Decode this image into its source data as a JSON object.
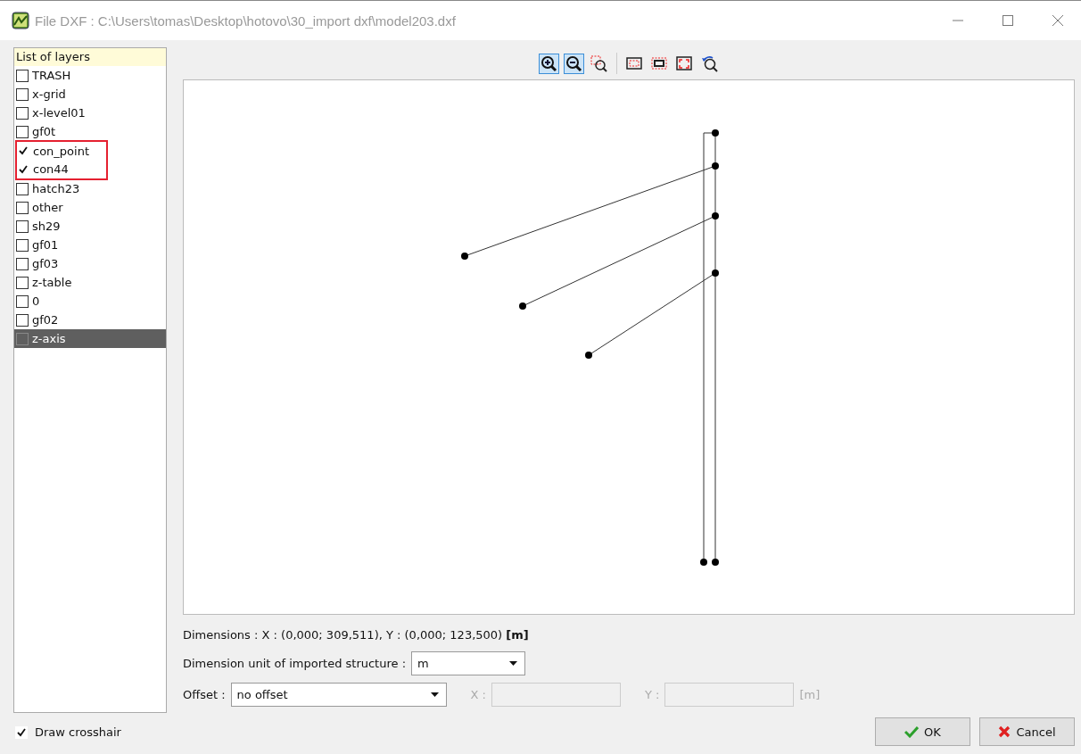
{
  "window": {
    "title": "File DXF : C:\\Users\\tomas\\Desktop\\hotovo\\30_import dxf\\model203.dxf"
  },
  "layers": {
    "header": "List of layers",
    "items": [
      {
        "label": "TRASH",
        "checked": false,
        "selected": false,
        "highlighted": false
      },
      {
        "label": "x-grid",
        "checked": false,
        "selected": false,
        "highlighted": false
      },
      {
        "label": "x-level01",
        "checked": false,
        "selected": false,
        "highlighted": false
      },
      {
        "label": "gf0t",
        "checked": false,
        "selected": false,
        "highlighted": false
      },
      {
        "label": "con_point",
        "checked": true,
        "selected": false,
        "highlighted": true
      },
      {
        "label": "con44",
        "checked": true,
        "selected": false,
        "highlighted": true
      },
      {
        "label": "hatch23",
        "checked": false,
        "selected": false,
        "highlighted": false
      },
      {
        "label": "other",
        "checked": false,
        "selected": false,
        "highlighted": false
      },
      {
        "label": "sh29",
        "checked": false,
        "selected": false,
        "highlighted": false
      },
      {
        "label": "gf01",
        "checked": false,
        "selected": false,
        "highlighted": false
      },
      {
        "label": "gf03",
        "checked": false,
        "selected": false,
        "highlighted": false
      },
      {
        "label": "z-table",
        "checked": false,
        "selected": false,
        "highlighted": false
      },
      {
        "label": "0",
        "checked": false,
        "selected": false,
        "highlighted": false
      },
      {
        "label": "gf02",
        "checked": false,
        "selected": false,
        "highlighted": false
      },
      {
        "label": "z-axis",
        "checked": false,
        "selected": true,
        "highlighted": false
      }
    ]
  },
  "toolbar": [
    {
      "kind": "zoom-in",
      "active": true
    },
    {
      "kind": "zoom-out",
      "active": true
    },
    {
      "kind": "zoom-window",
      "active": false
    },
    {
      "kind": "separator"
    },
    {
      "kind": "frame",
      "active": false
    },
    {
      "kind": "frame-bold",
      "active": false
    },
    {
      "kind": "fit",
      "active": false
    },
    {
      "kind": "undo-zoom",
      "active": false
    }
  ],
  "dimensions": "Dimensions : X : (0,000; 309,511), Y : (0,000; 123,500) **[m]**",
  "unit": {
    "label": "Dimension unit of imported structure :",
    "value": "m"
  },
  "offset": {
    "label": "Offset :",
    "value": "no offset",
    "x_label": "X :",
    "y_label": "Y :",
    "unit": "[m]",
    "disabled": true
  },
  "crosshair": {
    "label": "Draw crosshair",
    "checked": true
  },
  "buttons": [
    {
      "kind": "ok",
      "label": "OK"
    },
    {
      "kind": "cancel",
      "label": "Cancel"
    }
  ]
}
